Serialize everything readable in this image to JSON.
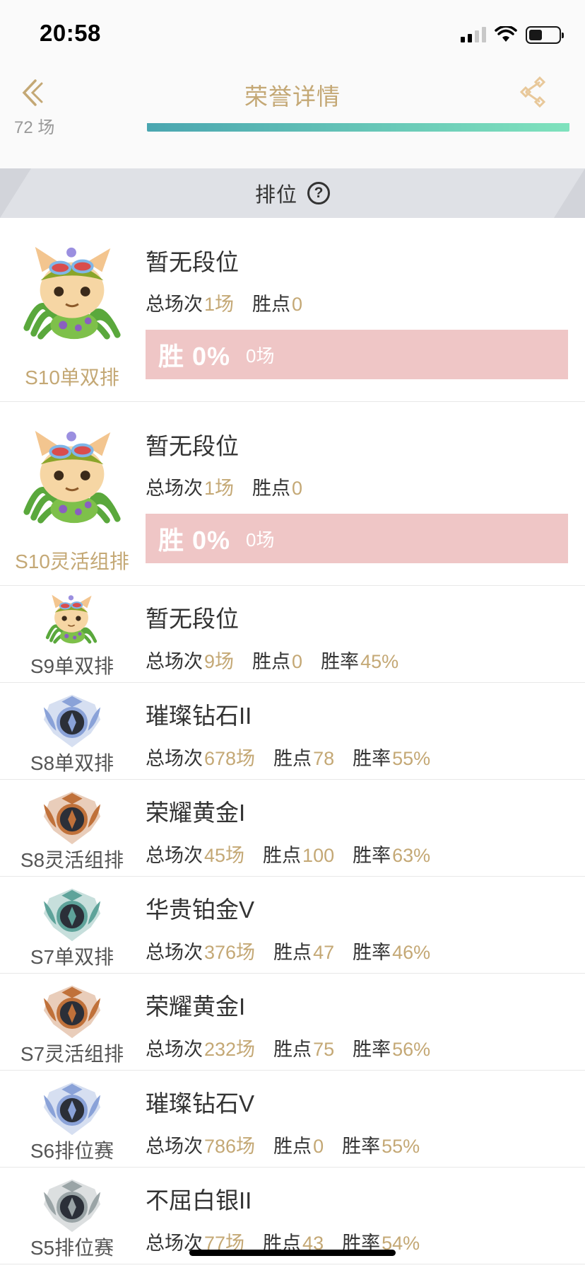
{
  "status_bar": {
    "time": "20:58"
  },
  "nav": {
    "title": "荣誉详情"
  },
  "progress": {
    "label": "72 场"
  },
  "section": {
    "title": "排位",
    "help": "?"
  },
  "labels": {
    "total": "总场次",
    "points": "胜点",
    "winrate": "胜率"
  },
  "rows": [
    {
      "season": "S10单双排",
      "tier": "暂无段位",
      "total": "1场",
      "points": "0",
      "win_pct": "胜 0%",
      "win_games": "0场",
      "icon": "teemo-avatar-icon"
    },
    {
      "season": "S10灵活组排",
      "tier": "暂无段位",
      "total": "1场",
      "points": "0",
      "win_pct": "胜 0%",
      "win_games": "0场",
      "icon": "teemo-avatar-icon"
    },
    {
      "season": "S9单双排",
      "tier": "暂无段位",
      "total": "9场",
      "points": "0",
      "winrate": "45%",
      "icon": "teemo-avatar-icon"
    },
    {
      "season": "S8单双排",
      "tier": "璀璨钻石II",
      "total": "678场",
      "points": "78",
      "winrate": "55%",
      "icon": "diamond-rank-icon"
    },
    {
      "season": "S8灵活组排",
      "tier": "荣耀黄金I",
      "total": "45场",
      "points": "100",
      "winrate": "63%",
      "icon": "gold-rank-icon"
    },
    {
      "season": "S7单双排",
      "tier": "华贵铂金V",
      "total": "376场",
      "points": "47",
      "winrate": "46%",
      "icon": "platinum-rank-icon"
    },
    {
      "season": "S7灵活组排",
      "tier": "荣耀黄金I",
      "total": "232场",
      "points": "75",
      "winrate": "56%",
      "icon": "gold-rank-icon"
    },
    {
      "season": "S6排位赛",
      "tier": "璀璨钻石V",
      "total": "786场",
      "points": "0",
      "winrate": "55%",
      "icon": "diamond-rank-icon"
    },
    {
      "season": "S5排位赛",
      "tier": "不屈白银II",
      "total": "77场",
      "points": "43",
      "winrate": "54%",
      "icon": "silver-rank-icon"
    }
  ],
  "colors": {
    "accent": "#c4a875",
    "win_box": "#efc6c6",
    "progress_start": "#4aa6b0",
    "progress_end": "#7fe2bd"
  }
}
